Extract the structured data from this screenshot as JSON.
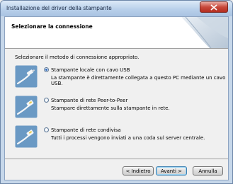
{
  "window": {
    "title": "Installazione del driver della stampante"
  },
  "header": {
    "title": "Selezionare la connessione"
  },
  "instruction": "Selezionare il metodo di connessione appropriato.",
  "options": [
    {
      "label": "Stampante locale con cavo USB",
      "description": "La stampante è direttamente collegata a questo PC mediante un cavo USB.",
      "selected": true
    },
    {
      "label": "Stampante di rete Peer-to-Peer",
      "description": "Stampare direttamente sulla stampante in rete.",
      "selected": false
    },
    {
      "label": "Stampante di rete condivisa",
      "description": "Tutti i processi vengono inviati a una coda sul server centrale.",
      "selected": false
    }
  ],
  "buttons": {
    "back": "< Indietro",
    "next": "Avanti >",
    "cancel": "Annulla"
  },
  "colors": {
    "title_bar": "#b9d0ea",
    "close_button": "#c8493c",
    "radio_selected": "#2d6ac1"
  }
}
